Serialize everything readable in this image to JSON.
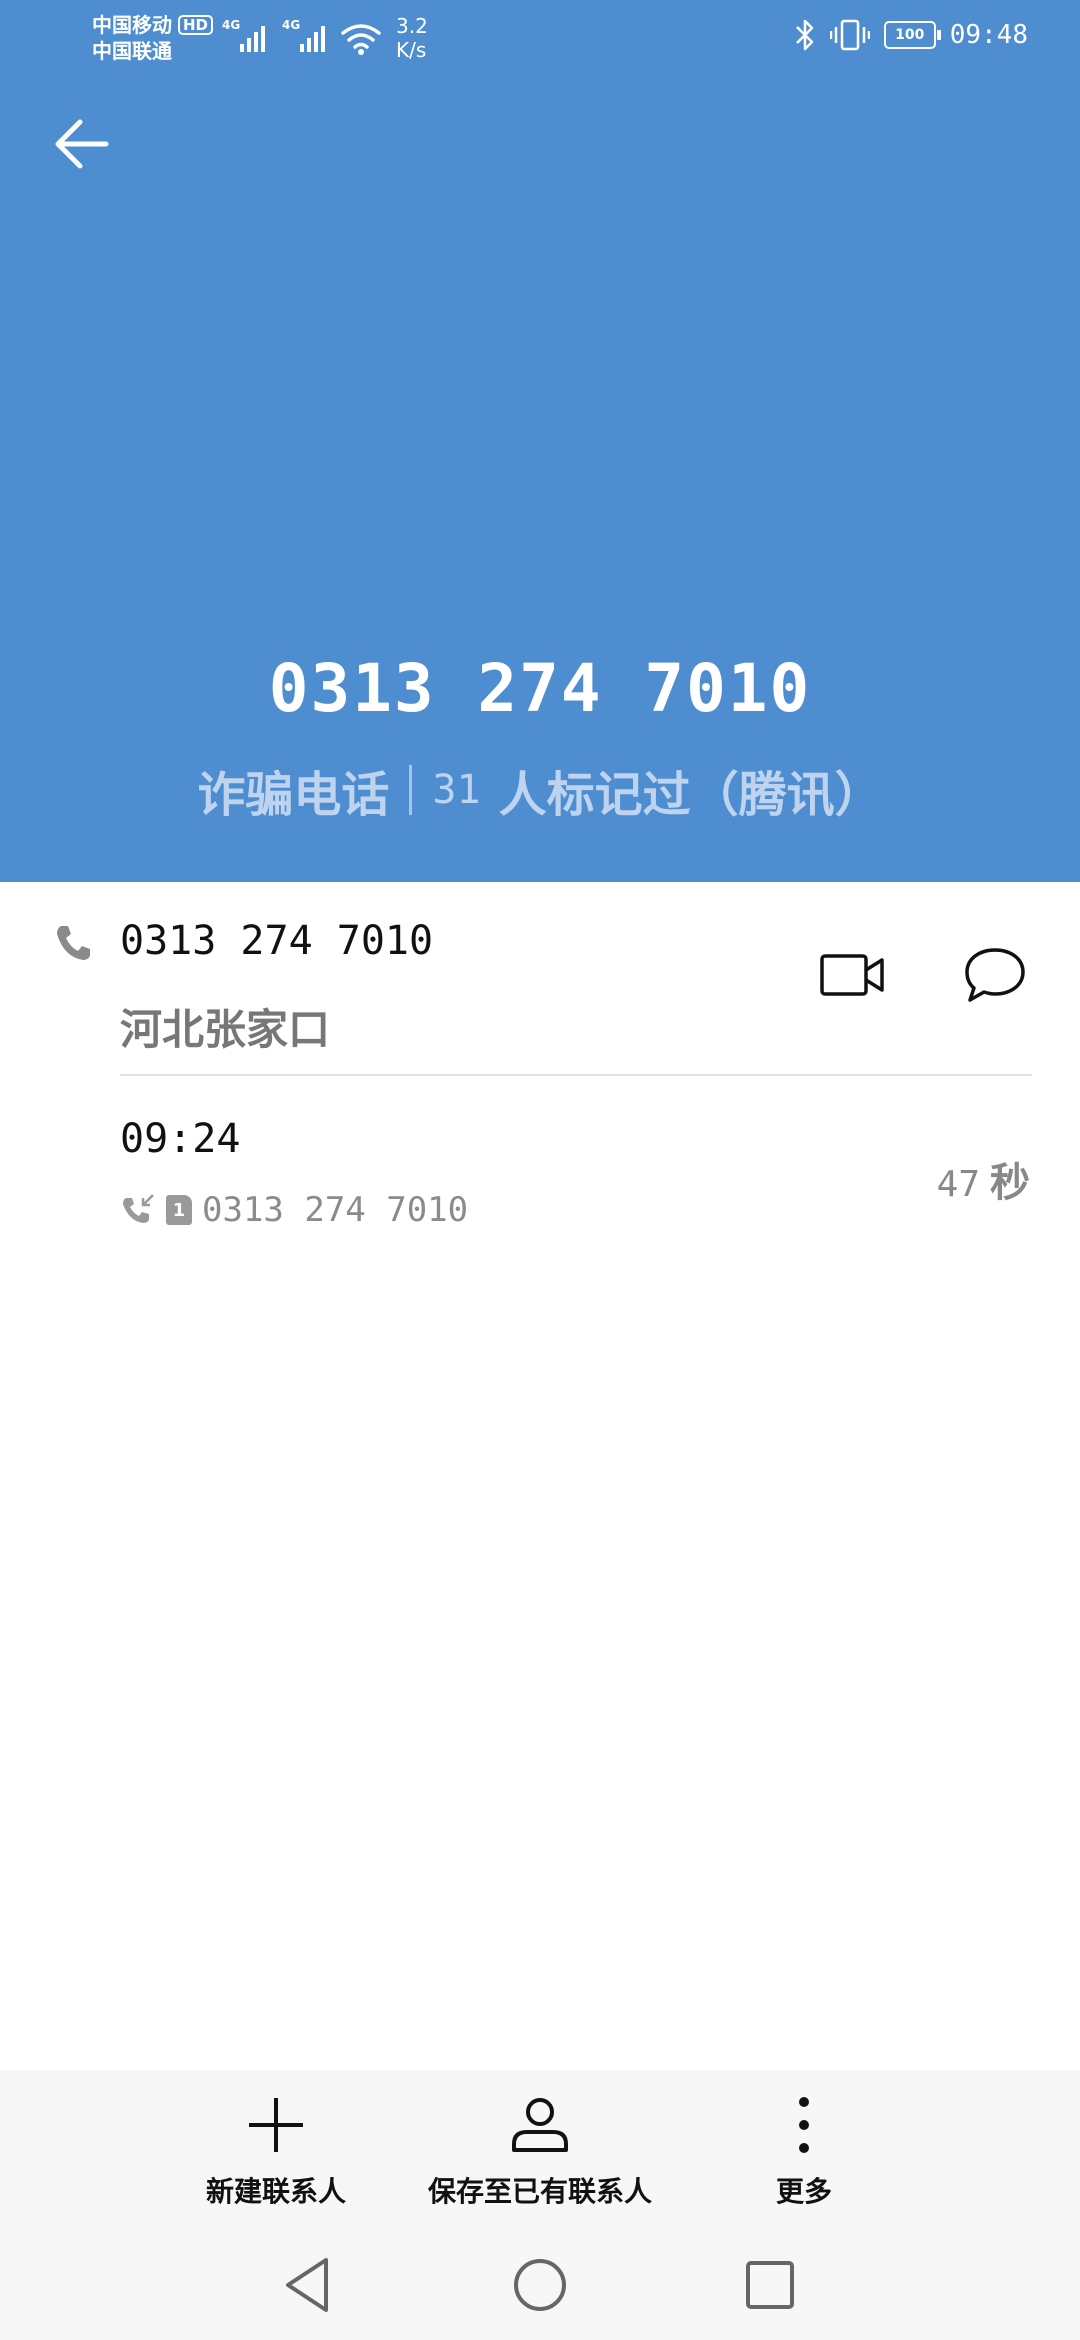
{
  "status_bar": {
    "carrier_1": "中国移动",
    "hd_badge": "HD",
    "carrier_2": "中国联通",
    "net_1": "4G",
    "net_2": "4G",
    "speed_value": "3.2",
    "speed_unit": "K/s",
    "battery_level": "100",
    "time": "09:48"
  },
  "header": {
    "number": "0313 274 7010",
    "tag_label": "诈骗电话",
    "tag_count": "31",
    "tag_suffix": "人标记过（腾讯）"
  },
  "call_info": {
    "number": "0313 274 7010",
    "location": "河北张家口"
  },
  "call_record": {
    "time": "09:24",
    "sim_slot": "1",
    "number": "0313 274 7010",
    "duration_value": "47",
    "duration_unit": "秒"
  },
  "actions": {
    "new_contact": "新建联系人",
    "save_existing": "保存至已有联系人",
    "more": "更多"
  },
  "colors": {
    "header_bg": "#4f8dd1",
    "tag_text": "#bdd3ee"
  },
  "icons": [
    "back-arrow-icon",
    "phone-icon",
    "video-call-icon",
    "message-icon",
    "incoming-call-icon",
    "sim-icon",
    "plus-icon",
    "person-icon",
    "more-vertical-icon",
    "nav-back-icon",
    "nav-home-icon",
    "nav-recents-icon"
  ]
}
